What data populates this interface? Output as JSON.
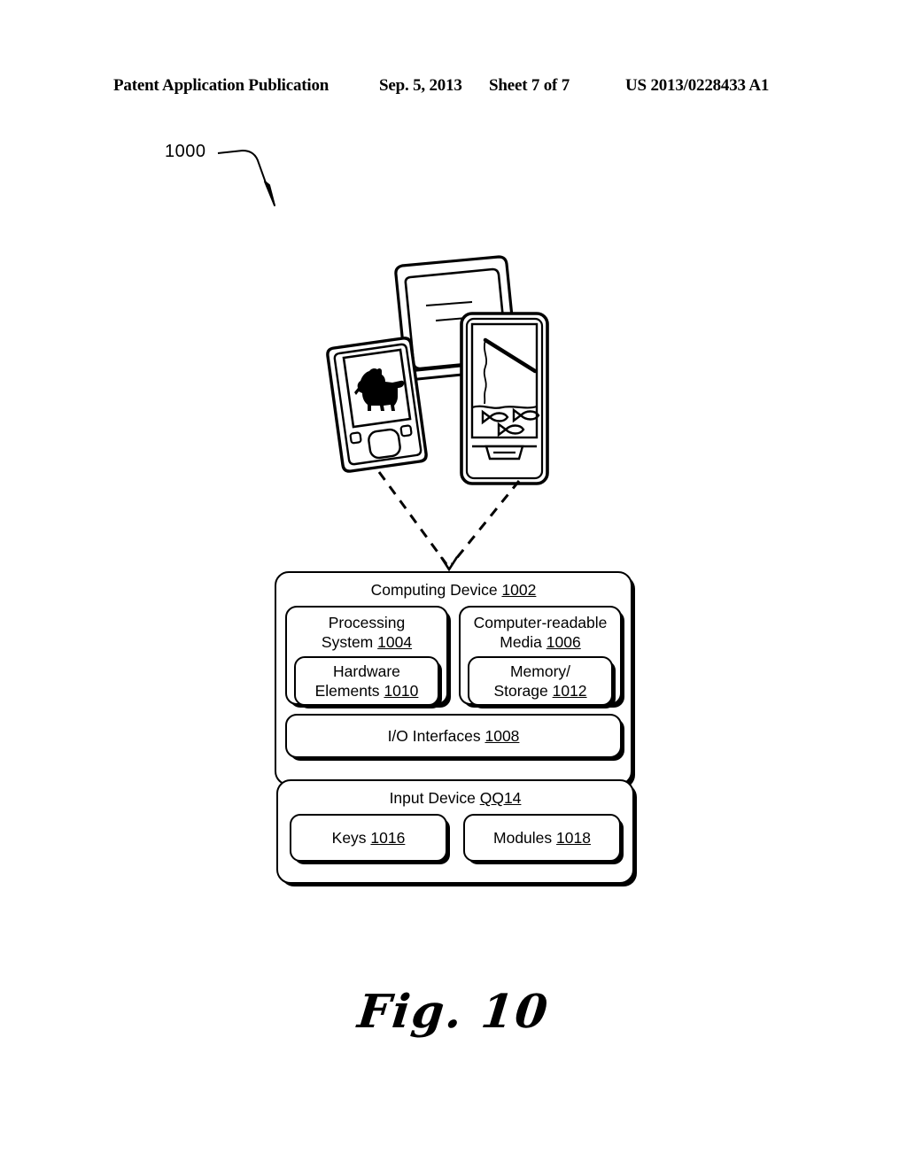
{
  "header": {
    "publication": "Patent Application Publication",
    "date": "Sep. 5, 2013",
    "sheet": "Sheet 7 of 7",
    "document_number": "US 2013/0228433 A1"
  },
  "figure": {
    "reference_numeral": "1000",
    "caption": "Fig. 10"
  },
  "devices": {
    "media_player": {
      "name": "portable-media-player",
      "screen_content": "dog-silhouette"
    },
    "tablet": {
      "name": "tablet-device",
      "screen_content": "text-lines"
    },
    "phone": {
      "name": "mobile-phone",
      "screen_content": "fishing-scene"
    }
  },
  "diagram": {
    "computing_device": {
      "title": "Computing Device",
      "ref": "1002",
      "processing_system": {
        "line1": "Processing",
        "line2": "System",
        "ref": "1004",
        "hardware_elements": {
          "line1": "Hardware",
          "line2": "Elements",
          "ref": "1010"
        }
      },
      "computer_readable_media": {
        "line1": "Computer-readable",
        "line2": "Media",
        "ref": "1006",
        "memory_storage": {
          "line1": "Memory/",
          "line2": "Storage",
          "ref": "1012"
        }
      },
      "io_interfaces": {
        "title": "I/O Interfaces",
        "ref": "1008"
      }
    },
    "input_device": {
      "title": "Input Device",
      "ref": "QQ14",
      "keys": {
        "title": "Keys",
        "ref": "1016"
      },
      "modules": {
        "title": "Modules",
        "ref": "1018"
      }
    }
  },
  "colors": {
    "ink": "#000000",
    "paper": "#ffffff"
  }
}
